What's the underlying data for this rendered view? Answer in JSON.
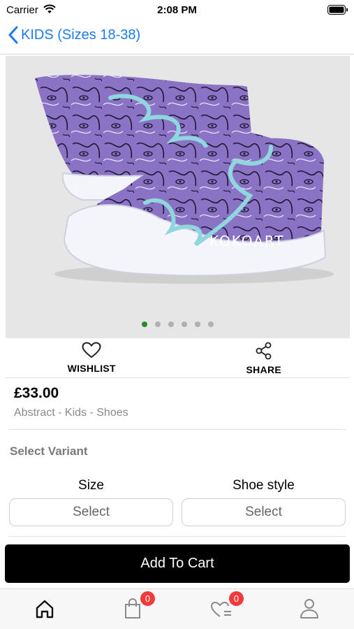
{
  "status_bar": {
    "carrier": "Carrier",
    "time": "2:08 PM"
  },
  "nav": {
    "title": "KIDS (Sizes 18-38)"
  },
  "gallery": {
    "slide_count": 6,
    "active_index": 0,
    "watermark": "KOKOART"
  },
  "actions": {
    "wishlist_label": "WISHLIST",
    "share_label": "SHARE"
  },
  "product": {
    "price": "£33.00",
    "categories": "Abstract - Kids - Shoes"
  },
  "variants": {
    "title": "Select Variant",
    "size": {
      "label": "Size",
      "value": "Select"
    },
    "shoe_style": {
      "label": "Shoe style",
      "value": "Select"
    }
  },
  "cart_button": {
    "label": "Add To Cart"
  },
  "tab_bar": {
    "cart_count": "0",
    "wishlist_count": "0"
  },
  "colors": {
    "accent": "#1a7cf0",
    "badge": "#f23a3a",
    "active_dot": "#2a8a2a",
    "button": "#000000"
  }
}
